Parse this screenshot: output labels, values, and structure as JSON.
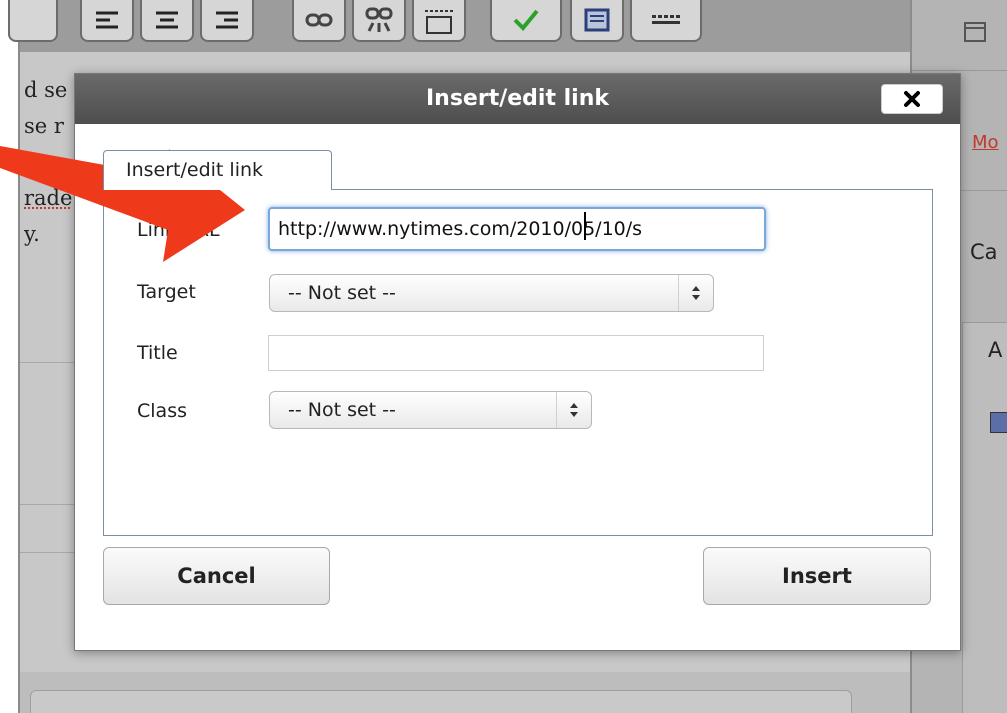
{
  "background": {
    "editor_lines": [
      "d se",
      "se r",
      "hor",
      "rade",
      "y."
    ],
    "sidebar": {
      "more_link": "Mo",
      "heading_1": "Ca",
      "heading_2": "A"
    }
  },
  "dialog": {
    "title": "Insert/edit link",
    "close_label": "✕",
    "tab_label": "Insert/edit link",
    "fields": {
      "link_url_label": "Link URL",
      "link_url_value": "http://www.nytimes.com/2010/05/10/s",
      "target_label": "Target",
      "target_value": "-- Not set --",
      "title_label": "Title",
      "title_value": "",
      "class_label": "Class",
      "class_value": "-- Not set --"
    },
    "buttons": {
      "cancel": "Cancel",
      "insert": "Insert"
    }
  },
  "colors": {
    "annotation_arrow": "#ee3a1b",
    "titlebar": "#5a5a5a",
    "focus_ring": "#7aa6da",
    "link_red": "#c0392b"
  },
  "icons": [
    "align-left-icon",
    "align-center-icon",
    "align-right-icon",
    "link-icon",
    "unlink-icon",
    "insert-more-icon",
    "spellcheck-icon",
    "fullscreen-icon",
    "kitchen-sink-icon",
    "close-icon",
    "select-arrows-icon",
    "annotation-arrow"
  ]
}
